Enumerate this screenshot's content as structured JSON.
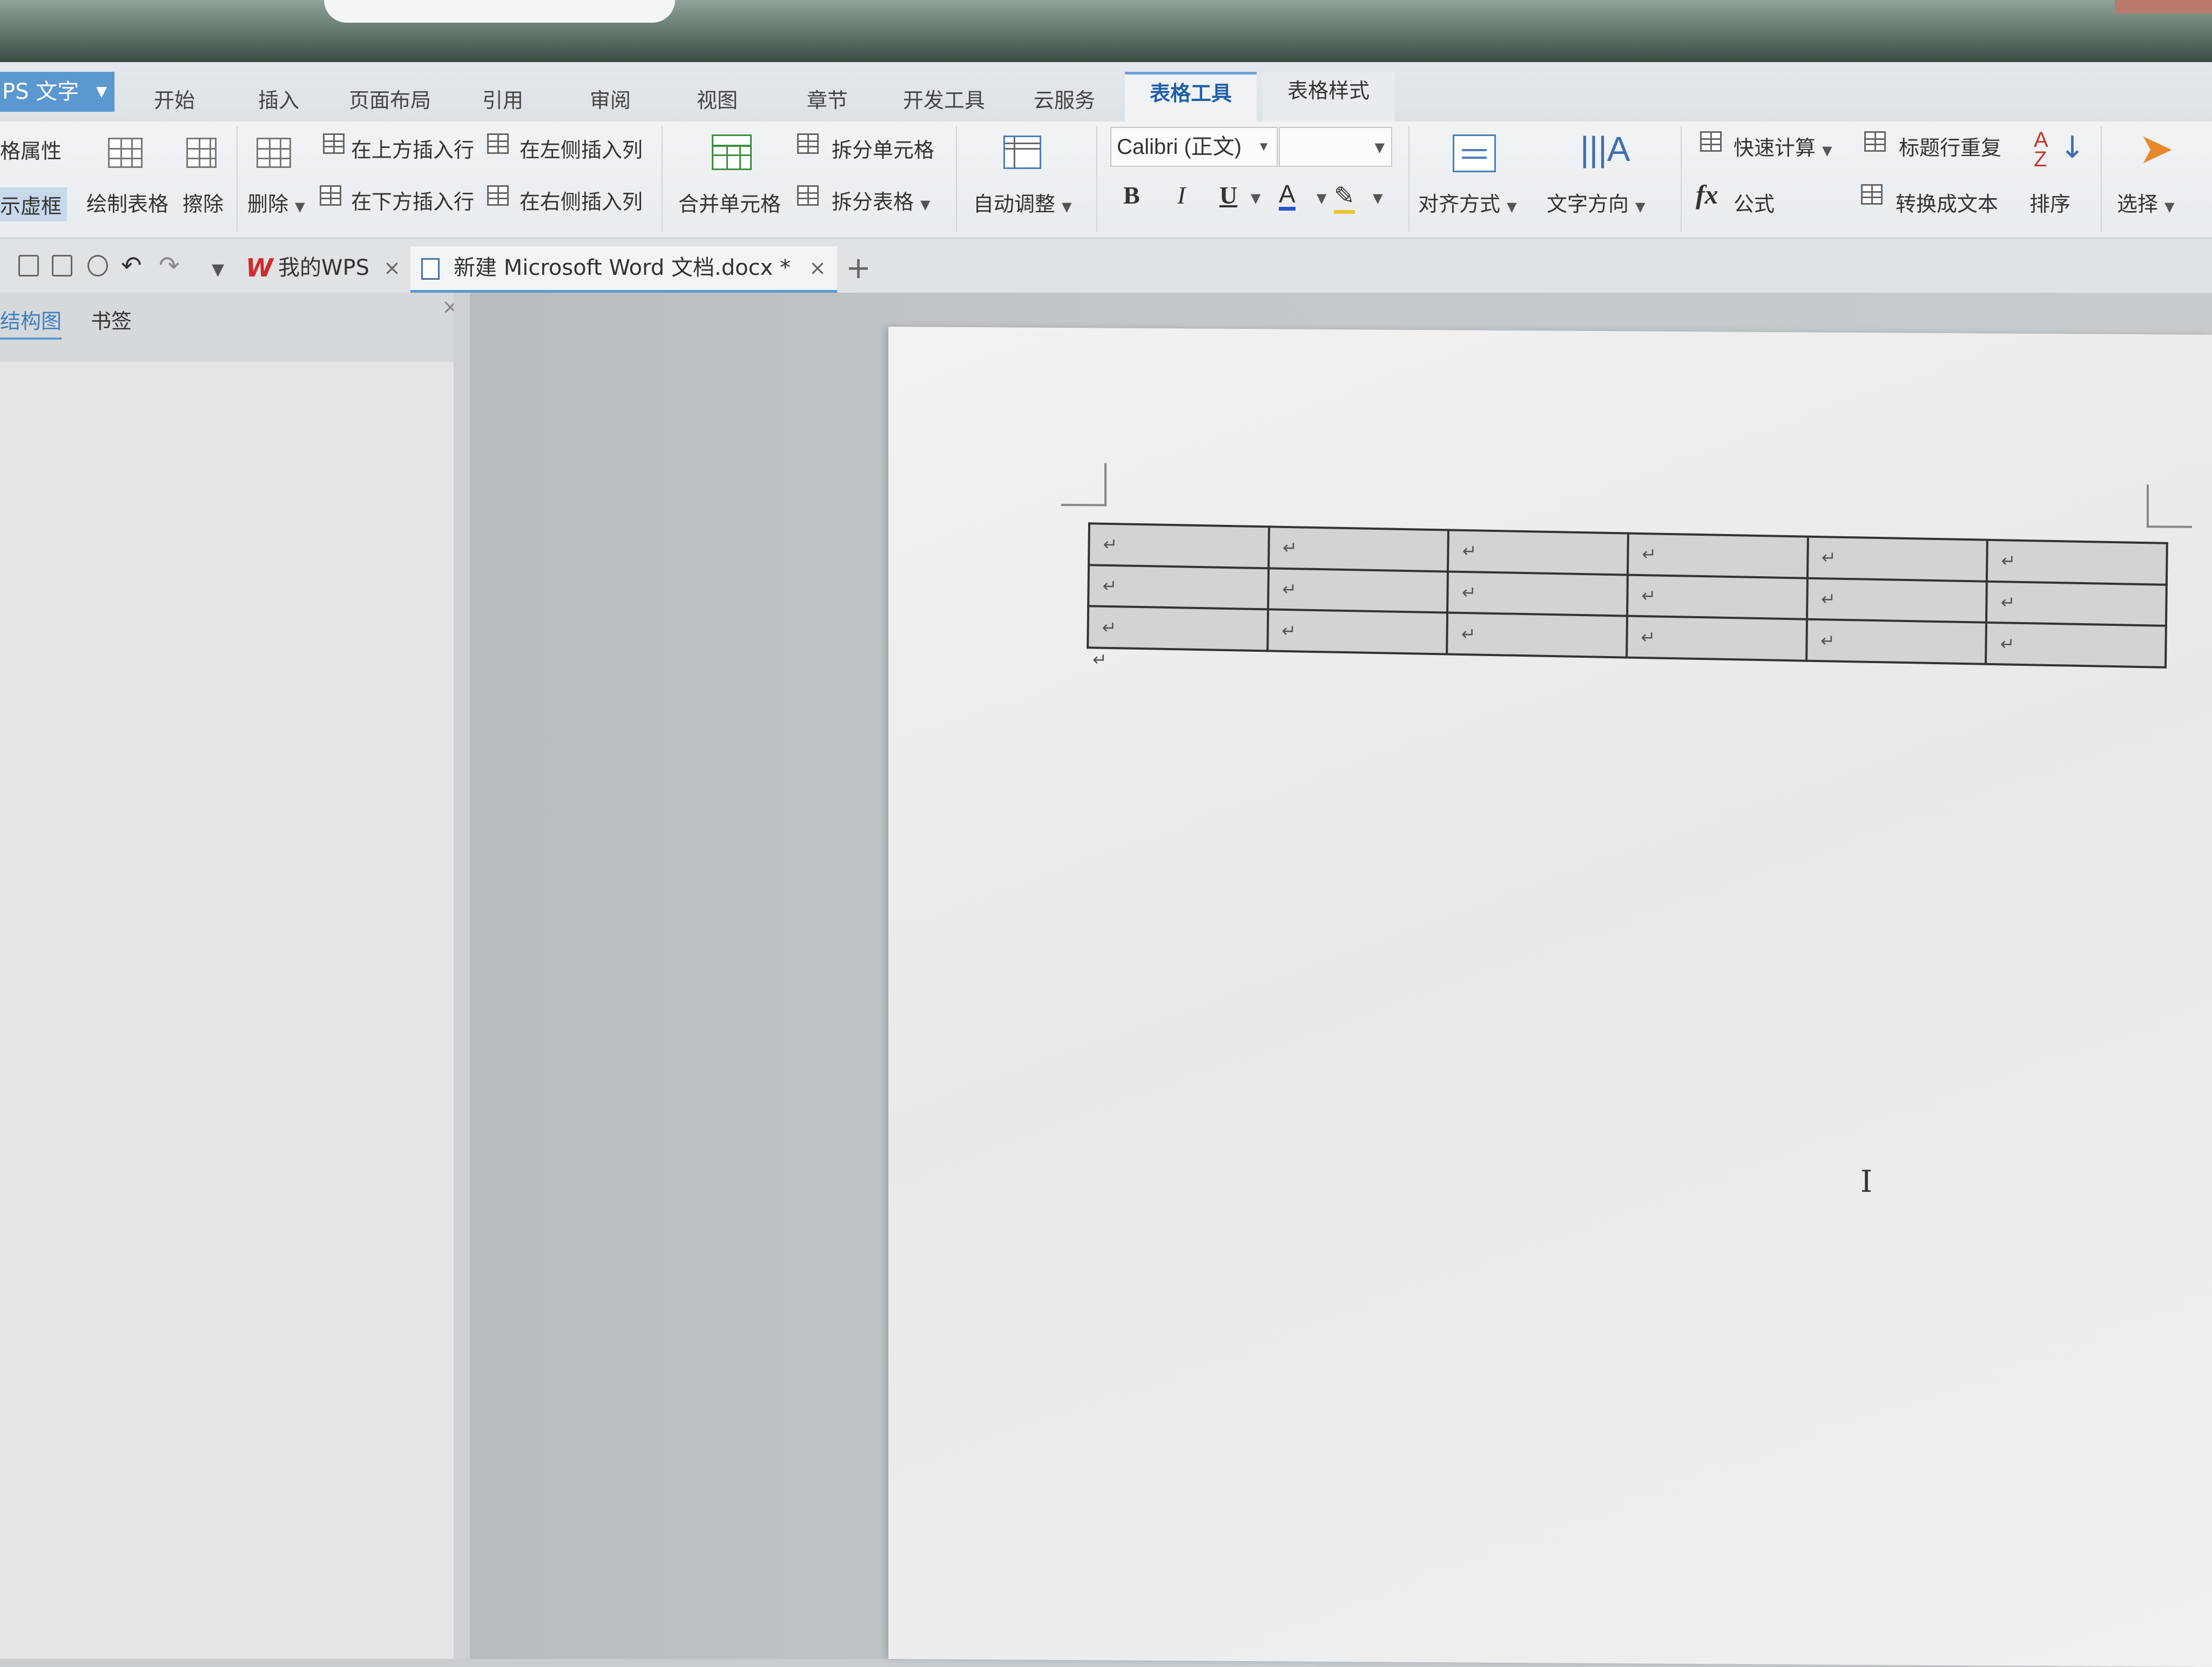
{
  "window": {
    "app_menu_label": "PS 文字"
  },
  "menu_tabs": [
    "开始",
    "插入",
    "页面布局",
    "引用",
    "审阅",
    "视图",
    "章节",
    "开发工具",
    "云服务",
    "表格工具",
    "表格样式"
  ],
  "ribbon": {
    "table_properties": "格属性",
    "show_gridlines": "示虚框",
    "draw_table": "绘制表格",
    "erase": "擦除",
    "delete": "删除",
    "insert_row_above": "在上方插入行",
    "insert_row_below": "在下方插入行",
    "insert_col_left": "在左侧插入列",
    "insert_col_right": "在右侧插入列",
    "merge_cells": "合并单元格",
    "split_cells": "拆分单元格",
    "split_table": "拆分表格",
    "auto_fit": "自动调整",
    "font_name": "Calibri (正文)",
    "font_size": "",
    "bold": "B",
    "italic": "I",
    "underline": "U",
    "font_color": "A",
    "alignment": "对齐方式",
    "text_direction": "文字方向",
    "quick_calc": "快速计算",
    "repeat_header": "标题行重复",
    "formula_fx": "fx",
    "formula": "公式",
    "convert_to_text": "转换成文本",
    "sort": "排序",
    "sort_icon_text": "A Z",
    "select": "选择"
  },
  "doc_tabs": {
    "home_logo": "W",
    "home": "我的WPS",
    "active_doc": "新建 Microsoft Word 文档.docx *",
    "close": "×",
    "add": "+"
  },
  "nav_pane": {
    "tab_structure": "结构图",
    "tab_bookmarks": "书签",
    "close": "×"
  },
  "document": {
    "table_rows": [
      [
        "↵",
        "↵",
        "↵",
        "↵",
        "↵",
        "↵"
      ],
      [
        "↵",
        "↵",
        "↵",
        "↵",
        "↵",
        "↵"
      ],
      [
        "↵",
        "↵",
        "↵",
        "↵",
        "↵",
        "↵"
      ]
    ],
    "paragraph_mark": "↵",
    "cursor": "I"
  },
  "colors": {
    "accent": "#5b98cf",
    "active_tab_text": "#1f5fa8",
    "wps_red": "#d02b2b"
  }
}
